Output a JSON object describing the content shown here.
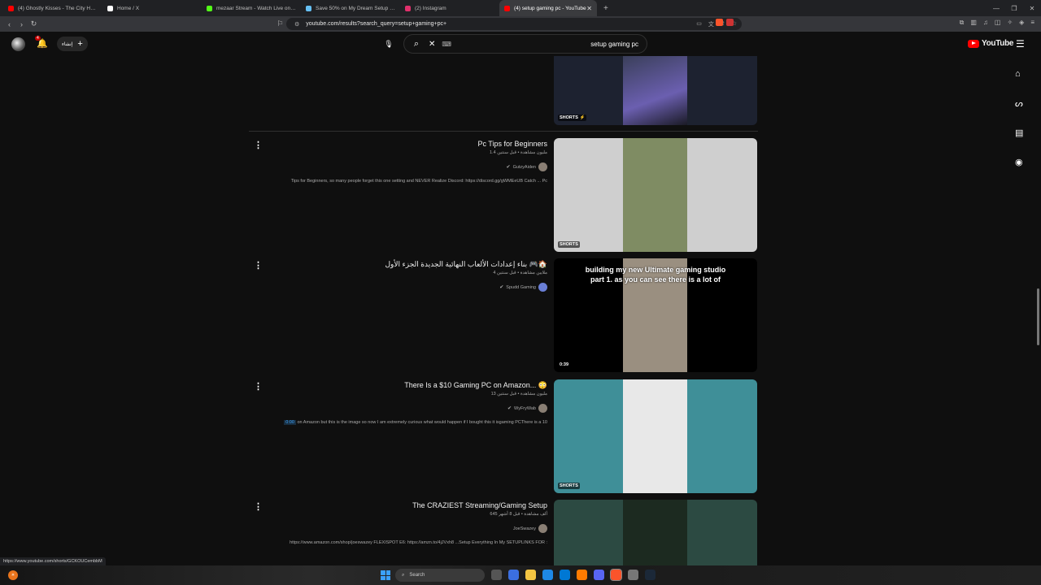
{
  "browser": {
    "tabs": [
      {
        "label": "(4) Ghostly Kisses - The City Holds M",
        "color": "#ff0000"
      },
      {
        "label": "Home / X",
        "color": "#ffffff"
      },
      {
        "label": "mezaar Stream - Watch Live on Kick",
        "color": "#53fc18"
      },
      {
        "label": "Save 50% on My Dream Setup on St",
        "color": "#66c0f4"
      },
      {
        "label": "(2) Instagram",
        "color": "#e1306c"
      },
      {
        "label": "(4) setup gaming pc - YouTube",
        "color": "#ff0000",
        "active": true
      }
    ],
    "url": "youtube.com/results?search_query=setup+gaming+pc+",
    "status_url": "https://www.youtube.com/shorts/GCKOUCembbM"
  },
  "youtube": {
    "create_label": "إنشاء",
    "notification_count": "4",
    "search_query": "setup gaming pc",
    "logo_text": "YouTube"
  },
  "results": [
    {
      "title": "Pc Tips for Beginners",
      "meta": "1.4 مليون مشاهدة • قبل سنتين",
      "channel": "GutzyAiden",
      "verified": true,
      "description": "Tips for Beginners, so many people forget this one setting and NEVER Realize Discord: https://discord.gg/gWMEeUB Catch ... Pc",
      "thumb_label": "SHORTS",
      "thumb_text": "",
      "thumb_bg": "#cfcfcf",
      "inner_color": "#7f8c63"
    },
    {
      "title": "بناء إعدادات الألعاب النهائية الجديدة الجزء الأول 🎮🏠",
      "meta": "4 ملايين مشاهدة • قبل سنتين",
      "channel": "Spudd Gaming",
      "verified": true,
      "description": "",
      "thumb_label": "0:39",
      "thumb_text": "building my new Ultimate gaming studio part 1. as you can see there is a lot of",
      "thumb_bg": "#000000",
      "inner_color": "#9a8f80"
    },
    {
      "title": "There Is a $10 Gaming PC on Amazon... 😳",
      "meta": "13 مليون مشاهدة • قبل سنتين",
      "channel": "WyFryWab",
      "verified": true,
      "description": "on Amazon but this is the image so now I am extremely curious what would happen if I bought this it isgaming PCThere is a 10",
      "desc_highlight": "0:00",
      "thumb_label": "SHORTS",
      "thumb_text": "",
      "thumb_bg": "#3f8f98",
      "inner_color": "#e8e8e8"
    },
    {
      "title": "The CRAZIEST Streaming/Gaming Setup",
      "meta": "645 ألف مشاهدة • قبل 8 أشهر",
      "channel": "JoeSwazey",
      "verified": false,
      "description": "https://www.amazon.com/shop/joeswazey FLEXISPOT E6: https://amzn.to/4jJVxh8 ...Setup Everything In My SETUPLINKS FOR :",
      "thumb_label": "",
      "thumb_text": "",
      "thumb_bg": "#2c4a42",
      "inner_color": "#1c2a20"
    }
  ],
  "taskbar": {
    "search_label": "Search"
  }
}
